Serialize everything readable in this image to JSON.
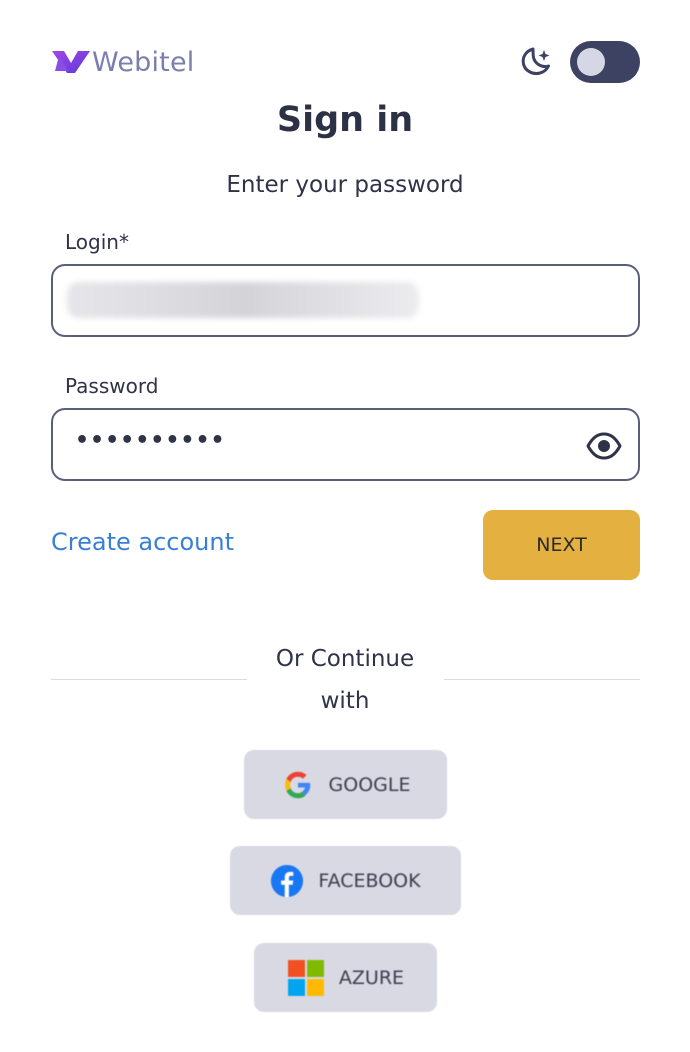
{
  "brand": {
    "name": "Webitel"
  },
  "theme": {
    "moon_icon": "moon-stars-icon",
    "toggle_state": "off"
  },
  "page": {
    "title": "Sign in",
    "subtitle": "Enter your password"
  },
  "login_field": {
    "label": "Login*",
    "value": ""
  },
  "password_field": {
    "label": "Password",
    "value": "••••••••••",
    "toggle_icon": "eye-icon"
  },
  "actions": {
    "create_account": "Create account",
    "next": "NEXT"
  },
  "divider": {
    "text_line1": "Or Continue",
    "text_line2": "with"
  },
  "social": [
    {
      "label": "GOOGLE",
      "icon": "google-icon"
    },
    {
      "label": "FACEBOOK",
      "icon": "facebook-icon"
    },
    {
      "label": "AZURE",
      "icon": "microsoft-icon"
    }
  ],
  "colors": {
    "accent": "#e4b03f",
    "link": "#3a7fd6",
    "toggle_bg": "#3d4263",
    "social_bg": "#d8d9e3",
    "logo_purple": "#7b3fe0"
  }
}
